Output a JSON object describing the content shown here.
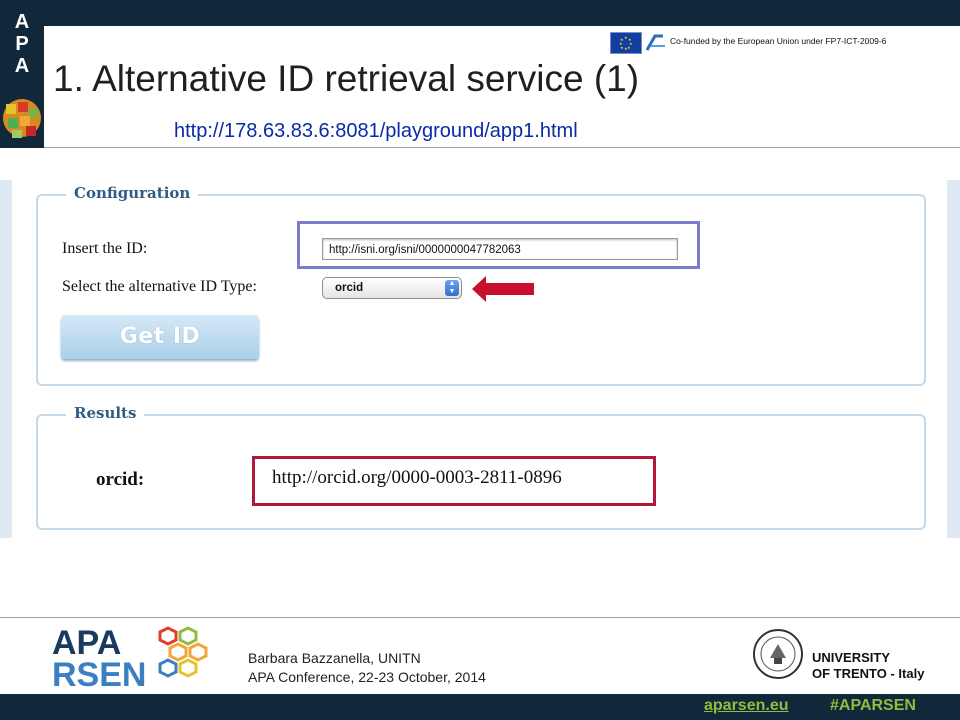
{
  "header": {
    "cofunded": "Co-funded by the European Union under FP7-ICT-2009-6",
    "title": "1. Alternative ID retrieval service (1)",
    "url": "http://178.63.83.6:8081/playground/app1.html"
  },
  "configuration": {
    "legend": "Configuration",
    "insert_label": "Insert the ID:",
    "id_value": "http://isni.org/isni/0000000047782063",
    "select_label": "Select the alternative ID Type:",
    "select_value": "orcid",
    "button_label": "Get ID"
  },
  "results": {
    "legend": "Results",
    "label": "orcid:",
    "value": "http://orcid.org/0000-0003-2811-0896"
  },
  "footer": {
    "author": "Barbara Bazzanella, UNITN",
    "conference": "APA Conference, 22-23 October, 2014",
    "logo_line1": "APA",
    "logo_line2": "RSEN",
    "university_line1": "UNIVERSITY",
    "university_line2": "OF TRENTO - Italy",
    "site": "aparsen.eu",
    "hashtag": "#APARSEN"
  },
  "colors": {
    "header_bar": "#11283b",
    "input_highlight": "#7c7ccc",
    "result_highlight": "#b2183c",
    "arrow": "#c8102e",
    "footer_link": "#8ebd3f"
  }
}
